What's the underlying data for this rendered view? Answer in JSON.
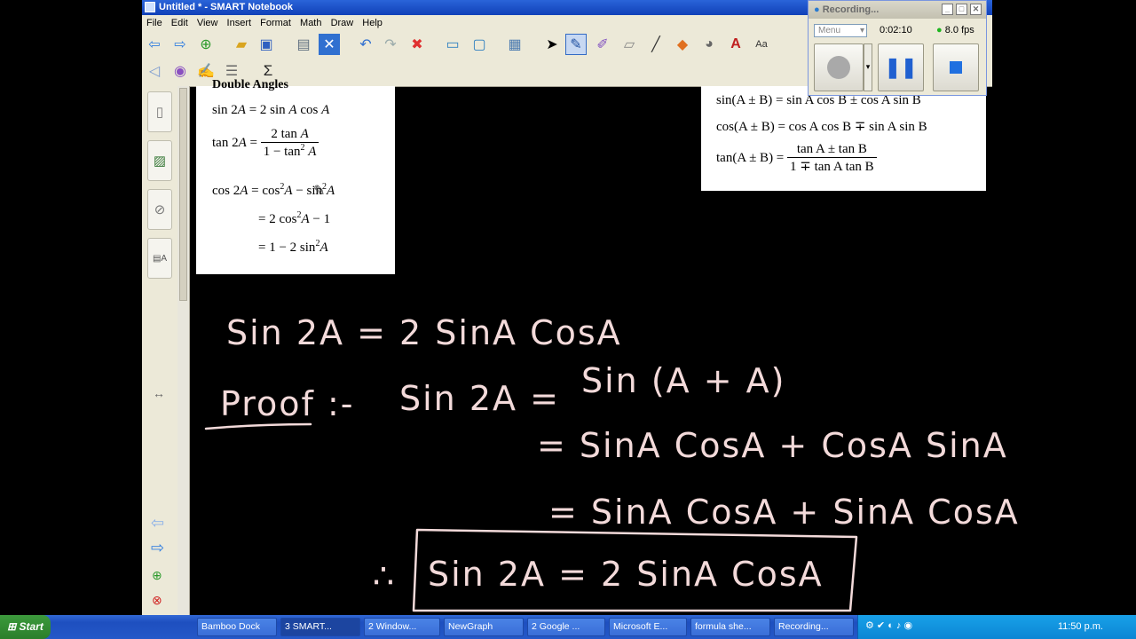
{
  "window": {
    "title": "Untitled * - SMART Notebook"
  },
  "menu": [
    "File",
    "Edit",
    "View",
    "Insert",
    "Format",
    "Math",
    "Draw",
    "Help"
  ],
  "recorder": {
    "title": "Recording...",
    "menu_label": "Menu",
    "time": "0:02:10",
    "fps": "8.0 fps"
  },
  "double_angles": {
    "heading": "Double Angles",
    "l1_left": "sin 2",
    "l1_right": "= 2 sin",
    "l1_tail": "cos",
    "tan_left": "tan 2",
    "tan_num": "2 tan",
    "tan_den": "1 − tan",
    "cos_left": "cos 2",
    "cos_right": "= cos",
    "cos_mid": "sin",
    "cos2": "= 2 cos",
    "cos2_tail": "− 1",
    "cos3": "= 1 − 2 sin",
    "A": "A",
    "sq": "2"
  },
  "sum_angles": {
    "sin_line": "sin(A ± B) = sin A cos B ± cos A sin B",
    "cos_line": "cos(A ± B) = cos A cos B ∓ sin A sin B",
    "tan_left": "tan(A ± B) =",
    "tan_num": "tan A ± tan B",
    "tan_den": "1 ∓ tan A tan B"
  },
  "handwriting": {
    "line1": "Sin 2A  =  2 SinA CosA",
    "proof": "Proof :-",
    "line2a": "Sin 2A  =",
    "line2b": "Sin (A + A)",
    "line3": "= SinA CosA  + CosA SinA",
    "line4": "= SinA CosA + SinA CosA",
    "therefore": "∴",
    "result": "Sin 2A  =  2 SinA CosA"
  },
  "taskbar": {
    "start": "Start",
    "tasks": [
      "Bamboo Dock",
      "3 SMART...",
      "2 Window...",
      "NewGraph",
      "2 Google ...",
      "Microsoft E...",
      "formula she...",
      "Recording..."
    ],
    "clock": "11:50 p.m."
  }
}
